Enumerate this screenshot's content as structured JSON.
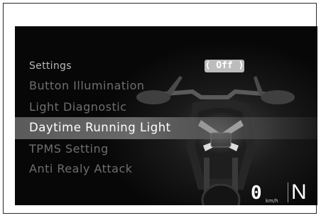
{
  "menu": {
    "header": "Settings",
    "items": [
      {
        "label": "Button Illumination",
        "selected": false
      },
      {
        "label": "Light Diagnostic",
        "selected": false
      },
      {
        "label": "Daytime Running Light",
        "selected": true
      },
      {
        "label": "TPMS Setting",
        "selected": false
      },
      {
        "label": "Anti Realy Attack",
        "selected": false
      }
    ]
  },
  "selected_value": "⟨ Off ⟩",
  "status": {
    "speed": "0",
    "speed_unit": "km/h",
    "gear": "N"
  },
  "icons": [
    "motorcycle-image"
  ]
}
